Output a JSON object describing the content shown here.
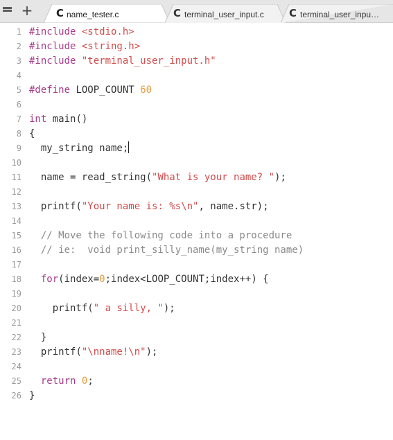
{
  "tabs": [
    {
      "label": "name_tester.c",
      "icon": "c-file-icon",
      "active": true
    },
    {
      "label": "terminal_user_input.c",
      "icon": "c-file-icon",
      "active": false
    },
    {
      "label": "terminal_user_inpu…",
      "icon": "c-file-icon",
      "active": false
    }
  ],
  "toolbar": {
    "menu_icon": "hamburger-menu-icon",
    "new_tab_label": "+"
  },
  "icon_glyph": "C",
  "editor": {
    "line_numbers": [
      "1",
      "2",
      "3",
      "4",
      "5",
      "6",
      "7",
      "8",
      "9",
      "10",
      "11",
      "12",
      "13",
      "14",
      "15",
      "16",
      "17",
      "18",
      "19",
      "20",
      "21",
      "22",
      "23",
      "24",
      "25",
      "26"
    ],
    "lines": {
      "l1_kw": "#include ",
      "l1_str": "<stdio.h>",
      "l2_kw": "#include ",
      "l2_str": "<string.h>",
      "l3_kw": "#include ",
      "l3_str": "\"terminal_user_input.h\"",
      "l5_kw": "#define ",
      "l5_name": "LOOP_COUNT ",
      "l5_num": "60",
      "l7_kw": "int",
      "l7_rest": " main()",
      "l8": "{",
      "l9": "  my_string name;",
      "l11_a": "  name = read_string(",
      "l11_str": "\"What is your name? \"",
      "l11_b": ");",
      "l13_a": "  printf(",
      "l13_str": "\"Your name is: %s\\n\"",
      "l13_b": ", name.str);",
      "l15": "  // Move the following code into a procedure",
      "l16": "  // ie:  void print_silly_name(my_string name)",
      "l18_kw": "for",
      "l18_a": "(index=",
      "l18_num": "0",
      "l18_b": ";index<LOOP_COUNT;index++) {",
      "l20_a": "    printf(",
      "l20_str": "\" a silly, \"",
      "l20_b": ");",
      "l22": "  }",
      "l23_a": "  printf(",
      "l23_str": "\"\\nname!\\n\"",
      "l23_b": ");",
      "l25_kw": "return ",
      "l25_num": "0",
      "l25_b": ";",
      "l26": "}"
    }
  },
  "colors": {
    "string": "#d14b4b",
    "number": "#e69a3f",
    "keyword": "#a63c8a",
    "comment": "#8a8a8a"
  }
}
